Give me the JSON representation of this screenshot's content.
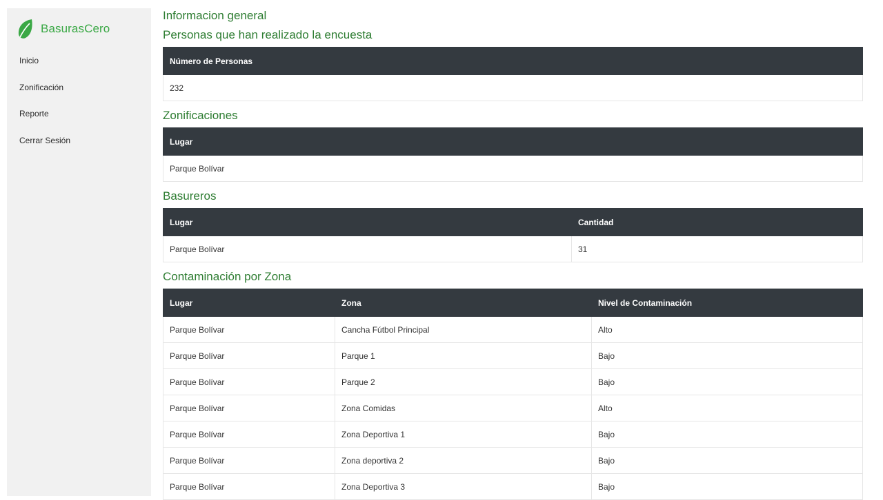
{
  "brand": {
    "name": "BasurasCero",
    "logo_icon": "leaf-icon",
    "accent": "#3aa845"
  },
  "nav": [
    {
      "label": "Inicio"
    },
    {
      "label": "Zonificación"
    },
    {
      "label": "Reporte"
    },
    {
      "label": "Cerrar Sesión"
    }
  ],
  "section_info": {
    "title": "Informacion general",
    "subtitle": "Personas que han realizado la encuesta"
  },
  "personas_table": {
    "headers": [
      "Número de Personas"
    ],
    "rows": [
      [
        "232"
      ]
    ]
  },
  "zonificaciones": {
    "title": "Zonificaciones",
    "headers": [
      "Lugar"
    ],
    "rows": [
      [
        "Parque Bolívar"
      ]
    ]
  },
  "basureros": {
    "title": "Basureros",
    "headers": [
      "Lugar",
      "Cantidad"
    ],
    "rows": [
      [
        "Parque Bolívar",
        "31"
      ]
    ]
  },
  "contaminacion": {
    "title": "Contaminación por Zona",
    "headers": [
      "Lugar",
      "Zona",
      "Nivel de Contaminación"
    ],
    "rows": [
      [
        "Parque Bolívar",
        "Cancha Fútbol Principal",
        "Alto"
      ],
      [
        "Parque Bolívar",
        "Parque 1",
        "Bajo"
      ],
      [
        "Parque Bolívar",
        "Parque 2",
        "Bajo"
      ],
      [
        "Parque Bolívar",
        "Zona Comidas",
        "Alto"
      ],
      [
        "Parque Bolívar",
        "Zona Deportiva 1",
        "Bajo"
      ],
      [
        "Parque Bolívar",
        "Zona deportiva 2",
        "Bajo"
      ],
      [
        "Parque Bolívar",
        "Zona Deportiva 3",
        "Bajo"
      ]
    ]
  },
  "colors": {
    "heading": "#2e7d32",
    "table_header_bg": "#343a40"
  }
}
